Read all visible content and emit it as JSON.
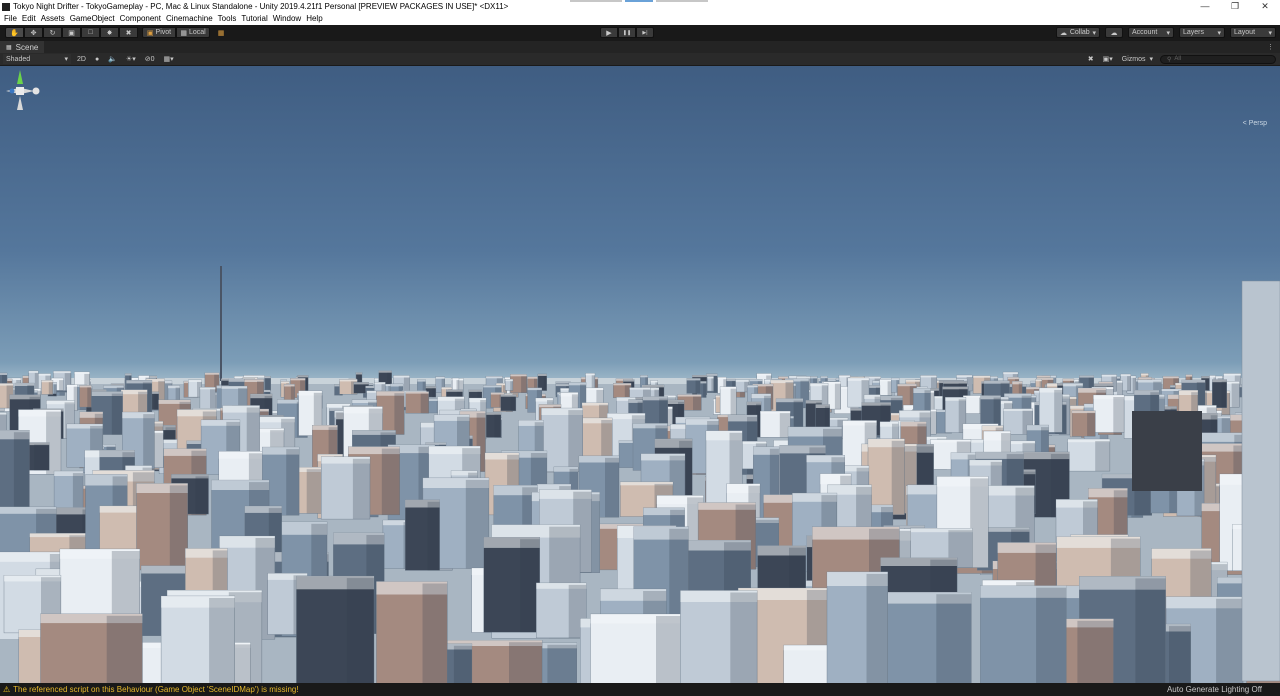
{
  "window": {
    "title": "Tokyo Night Drifter - TokyoGameplay - PC, Mac & Linux Standalone - Unity 2019.4.21f1 Personal [PREVIEW PACKAGES IN USE]* <DX11>",
    "minimize": "—",
    "restore": "❐",
    "close": "✕"
  },
  "menu": [
    "File",
    "Edit",
    "Assets",
    "GameObject",
    "Component",
    "Cinemachine",
    "Tools",
    "Tutorial",
    "Window",
    "Help"
  ],
  "toolbar": {
    "tools": [
      "hand-icon",
      "move-icon",
      "rotate-icon",
      "scale-icon",
      "rect-icon",
      "transform-icon",
      "custom-tool-icon"
    ],
    "pivot_label": "Pivot",
    "local_label": "Local",
    "play_icon": "▶",
    "pause_icon": "❚❚",
    "step_icon": "▶|",
    "collab_label": "Collab",
    "account_label": "Account",
    "layers_label": "Layers",
    "layout_label": "Layout"
  },
  "scene_tab": {
    "label": "Scene",
    "menu_icon": "⋮"
  },
  "scene_bar": {
    "shading_mode": "Shaded",
    "mode_2d": "2D",
    "hidden_count": "0",
    "gizmos_label": "Gizmos",
    "search_placeholder": "All"
  },
  "viewport": {
    "projection_label": "< Persp",
    "sky_top": "#3f5d82",
    "horizon": "#b8c8d1",
    "building_colors": [
      "#e9eef3",
      "#d2dbe4",
      "#bfcad6",
      "#9fb0c2",
      "#7f93a8",
      "#5d6e82",
      "#3c4656",
      "#cfbcb0",
      "#a48a80"
    ]
  },
  "status": {
    "warning_text": "The referenced script on this Behaviour (Game Object 'SceneIDMap') is missing!",
    "lighting_text": "Auto Generate Lighting Off"
  }
}
